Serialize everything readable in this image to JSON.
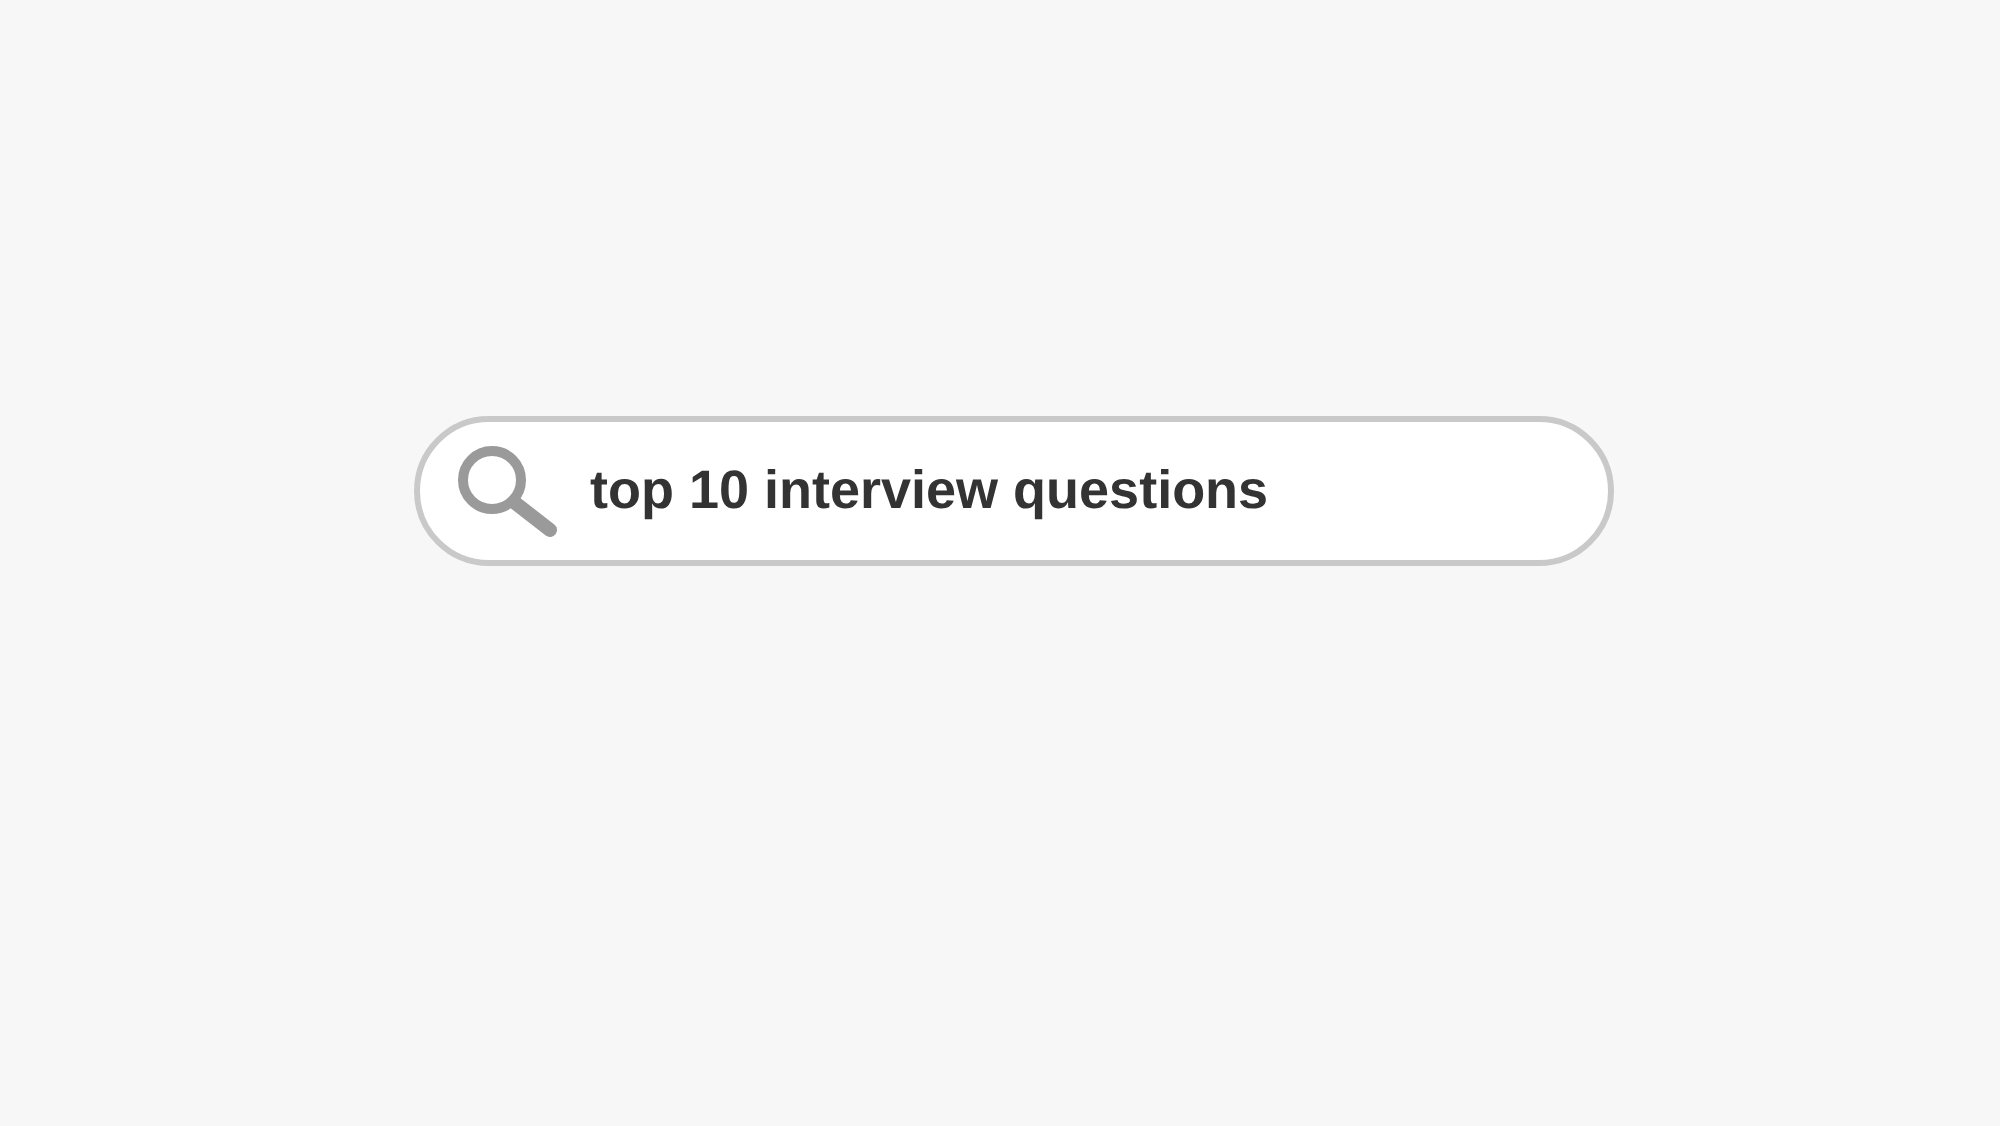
{
  "search": {
    "value": "top 10 interview questions"
  }
}
